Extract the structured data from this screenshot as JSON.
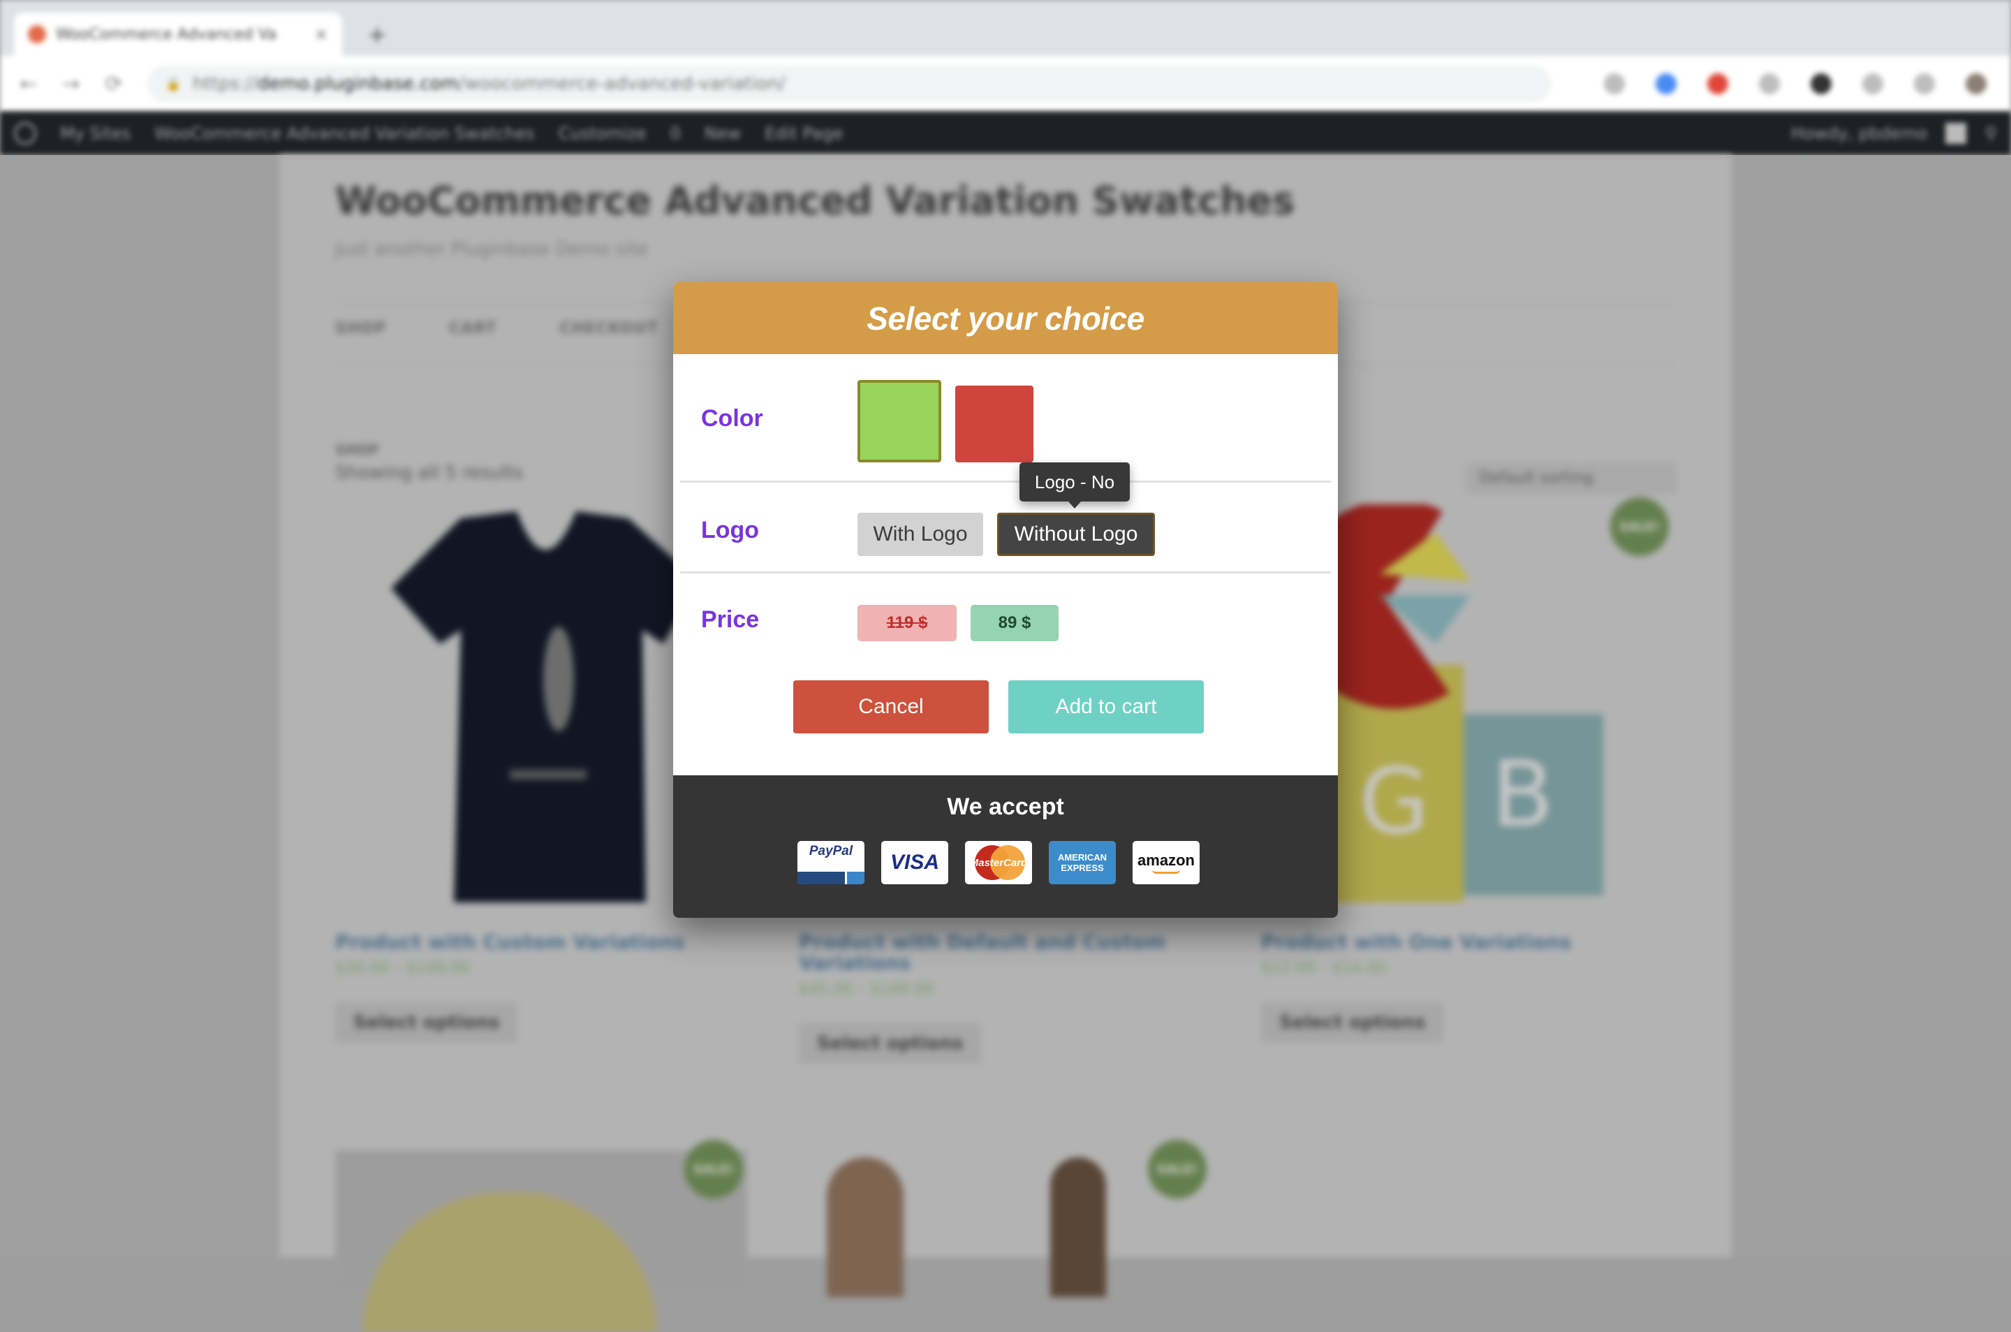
{
  "browser": {
    "tab_title": "WooCommerce Advanced Va",
    "tab_close": "×",
    "new_tab": "+",
    "url_scheme": "https://",
    "url_host": "demo.pluginbase.com",
    "url_path": "/woocommerce-advanced-variation/",
    "nav_back": "←",
    "nav_forward": "→",
    "nav_reload": "⟳",
    "lock": "🔒",
    "extension_colors": [
      "#bdbdbd",
      "#4a8af4",
      "#e0453a",
      "#bdbdbd",
      "#333333",
      "#bdbdbd",
      "#bdbdbd",
      "#8a7f74"
    ]
  },
  "admin_bar": {
    "items": [
      "My Sites",
      "WooCommerce Advanced Variation Swatches",
      "Customize",
      "0",
      "New",
      "Edit Page"
    ],
    "greeting": "Howdy, pbdemo"
  },
  "page": {
    "site_title": "WooCommerce Advanced Variation Swatches",
    "tagline": "Just another Pluginbase Demo site",
    "nav": [
      "SHOP",
      "CART",
      "CHECKOUT"
    ],
    "breadcrumb": "SHOP",
    "results": "Showing all 5 results",
    "sorting": "Default sorting",
    "products": [
      {
        "name": "Product with Custom Variations",
        "price": "$30.00 – $149.00",
        "button": "Select options"
      },
      {
        "name": "Product with Default and Custom Variations",
        "price": "$45.00 – $149.00",
        "button": "Select options"
      },
      {
        "name": "Product with One Variations",
        "price": "$12.00 – $14.00",
        "button": "Select options",
        "sale": "SALE!"
      }
    ],
    "sale_badge": "SALE!"
  },
  "modal": {
    "title": "Select your choice",
    "header_color": "#d49c48",
    "label_color": "#7a34e0",
    "color_row": {
      "label": "Color",
      "swatches": [
        {
          "name": "Green",
          "color": "#98d45c",
          "selected": true
        },
        {
          "name": "Red",
          "color": "#d0443e",
          "selected": false
        }
      ]
    },
    "logo_row": {
      "label": "Logo",
      "options": [
        {
          "label": "With Logo",
          "selected": false
        },
        {
          "label": "Without Logo",
          "selected": true
        }
      ],
      "tooltip": "Logo - No"
    },
    "price_row": {
      "label": "Price",
      "old_price": "119 $",
      "new_price": "89 $"
    },
    "buttons": {
      "cancel": "Cancel",
      "add_to_cart": "Add to cart"
    },
    "footer": {
      "title": "We accept",
      "cards": [
        "PayPal",
        "VISA",
        "MasterCard",
        "AMERICAN EXPRESS",
        "amazon"
      ]
    }
  }
}
